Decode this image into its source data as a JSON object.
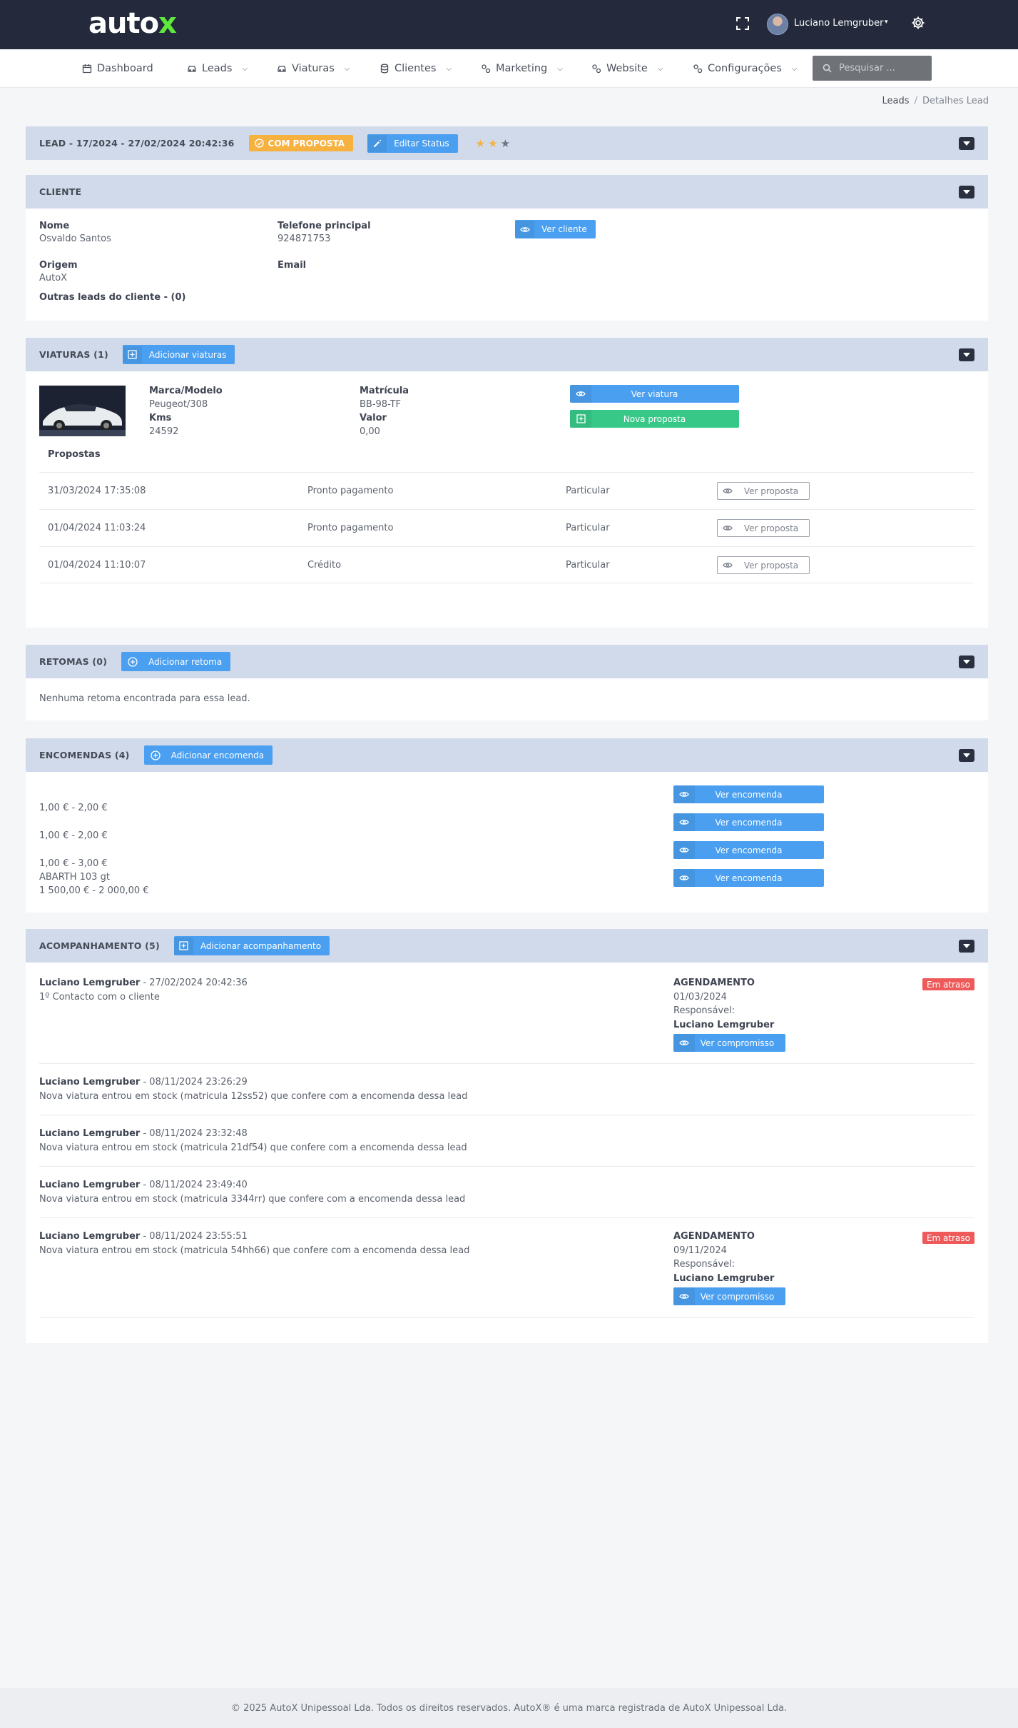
{
  "brand": {
    "logo_main": "auto",
    "logo_x": "x"
  },
  "topbar": {
    "user_name": "Luciano Lemgruber",
    "user_caret": "▾"
  },
  "nav": {
    "items": [
      {
        "label": "Dashboard",
        "icon": "calendar-icon",
        "has_chevron": false
      },
      {
        "label": "Leads",
        "icon": "car-icon",
        "has_chevron": true
      },
      {
        "label": "Viaturas",
        "icon": "car-icon",
        "has_chevron": true
      },
      {
        "label": "Clientes",
        "icon": "database-icon",
        "has_chevron": true
      },
      {
        "label": "Marketing",
        "icon": "cogs-icon",
        "has_chevron": true
      },
      {
        "label": "Website",
        "icon": "cogs-icon",
        "has_chevron": true
      },
      {
        "label": "Configurações",
        "icon": "cogs-icon",
        "has_chevron": true
      }
    ],
    "search_placeholder": "Pesquisar ..."
  },
  "breadcrumb": {
    "items": [
      "Leads",
      "Detalhes Lead"
    ],
    "separator": "/"
  },
  "lead": {
    "title": "LEAD - 17/2024 - 27/02/2024 20:42:36",
    "status": "COM PROPOSTA",
    "edit_status_label": "Editar Status",
    "rating": 2,
    "rating_max": 3,
    "colors": {
      "status": "#f6b13f",
      "star_on": "#f6b13f",
      "star_off": "#6b7280"
    }
  },
  "cliente": {
    "title": "CLIENTE",
    "nome_label": "Nome",
    "nome": "Osvaldo Santos",
    "telefone_label": "Telefone principal",
    "telefone": "924871753",
    "origem_label": "Origem",
    "origem": "AutoX",
    "email_label": "Email",
    "email": "",
    "outras_leads": "Outras leads do cliente - (0)",
    "ver_cliente_label": "Ver cliente"
  },
  "viaturas": {
    "title": "VIATURAS (1)",
    "add_label": "Adicionar viaturas",
    "marca_label": "Marca/Modelo",
    "marca": "Peugeot/308",
    "kms_label": "Kms",
    "kms": "24592",
    "matricula_label": "Matrícula",
    "matricula": "BB-98-TF",
    "valor_label": "Valor",
    "valor": "0,00",
    "ver_viatura_label": "Ver viatura",
    "nova_proposta_label": "Nova proposta",
    "propostas_title": "Propostas",
    "propostas": [
      {
        "date": "31/03/2024 17:35:08",
        "payment": "Pronto pagamento",
        "type": "Particular",
        "action": "Ver proposta"
      },
      {
        "date": "01/04/2024 11:03:24",
        "payment": "Pronto pagamento",
        "type": "Particular",
        "action": "Ver proposta"
      },
      {
        "date": "01/04/2024 11:10:07",
        "payment": "Crédito",
        "type": "Particular",
        "action": "Ver proposta"
      }
    ]
  },
  "retomas": {
    "title": "RETOMAS (0)",
    "add_label": "Adicionar retoma",
    "empty": "Nenhuma retoma encontrada para essa lead."
  },
  "encomendas": {
    "title": "ENCOMENDAS (4)",
    "add_label": "Adicionar encomenda",
    "lines": [
      "1,00 € - 2,00 €",
      "1,00 € - 2,00 €",
      "1,00 € - 3,00 €",
      "ABARTH 103 gt",
      "1 500,00 € - 2 000,00 €"
    ],
    "button_label": "Ver encomenda"
  },
  "acompanhamento": {
    "title": "ACOMPANHAMENTO (5)",
    "add_label": "Adicionar acompanhamento",
    "entries": [
      {
        "author": "Luciano Lemgruber",
        "date": " - 27/02/2024 20:42:36",
        "text": "1º Contacto com o cliente",
        "agendamento": {
          "label": "AGENDAMENTO",
          "date": "01/03/2024",
          "resp_label": "Responsável:",
          "resp": "Luciano Lemgruber",
          "button": "Ver compromisso",
          "badge": "Em atraso"
        }
      },
      {
        "author": "Luciano Lemgruber",
        "date": " - 08/11/2024 23:26:29",
        "text": "Nova viatura entrou em stock (matricula 12ss52) que confere com a encomenda dessa lead"
      },
      {
        "author": "Luciano Lemgruber",
        "date": " - 08/11/2024 23:32:48",
        "text": "Nova viatura entrou em stock (matricula 21df54) que confere com a encomenda dessa lead"
      },
      {
        "author": "Luciano Lemgruber",
        "date": " - 08/11/2024 23:49:40",
        "text": "Nova viatura entrou em stock (matricula 3344rr) que confere com a encomenda dessa lead"
      },
      {
        "author": "Luciano Lemgruber",
        "date": " - 08/11/2024 23:55:51",
        "text": "Nova viatura entrou em stock (matricula 54hh66) que confere com a encomenda dessa lead",
        "agendamento": {
          "label": "AGENDAMENTO",
          "date": "09/11/2024",
          "resp_label": "Responsável:",
          "resp": "Luciano Lemgruber",
          "button": "Ver compromisso",
          "badge": "Em atraso"
        }
      }
    ]
  },
  "footer": {
    "text": "© 2025 AutoX Unipessoal Lda. Todos os direitos reservados. AutoX® é uma marca registrada de AutoX Unipessoal Lda."
  }
}
